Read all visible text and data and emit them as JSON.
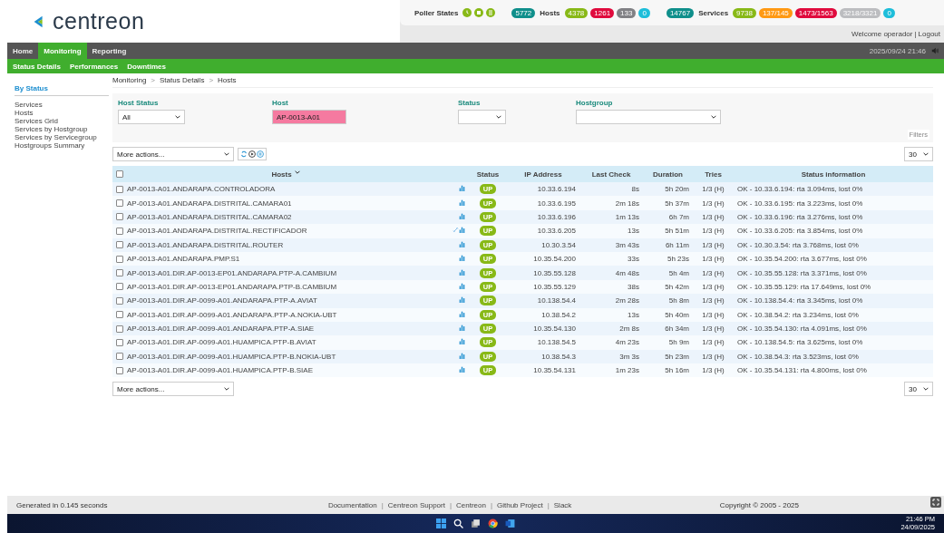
{
  "header": {
    "logo": "centreon",
    "poller_label": "Poller States",
    "hosts_label": "Hosts",
    "services_label": "Services",
    "host_badges": [
      {
        "text": "5772",
        "color": "#0f8f8b"
      },
      {
        "text": "4378",
        "color": "#88b917"
      },
      {
        "text": "1261",
        "color": "#e00b3d"
      },
      {
        "text": "133",
        "color": "#818185"
      },
      {
        "text": "0",
        "color": "#1ebeda"
      }
    ],
    "service_badges": [
      {
        "text": "14767",
        "color": "#0f8f8b"
      },
      {
        "text": "9738",
        "color": "#88b917"
      },
      {
        "text": "137/145",
        "color": "#ff9913"
      },
      {
        "text": "1473/1563",
        "color": "#e00b3d"
      },
      {
        "text": "3218/3321",
        "color": "#bcbdc0"
      },
      {
        "text": "0",
        "color": "#1ebeda"
      }
    ],
    "welcome": "Welcome operador",
    "welcome_separator": "|",
    "logout": "Logout",
    "datetime": "2025/09/24 21:46"
  },
  "menu": [
    {
      "label": "Home",
      "selected": false
    },
    {
      "label": "Monitoring",
      "selected": true
    },
    {
      "label": "Reporting",
      "selected": false
    }
  ],
  "submenu": [
    "Status Details",
    "Performances",
    "Downtimes"
  ],
  "sidebar": {
    "heading": "By Status",
    "items": [
      "Services",
      "Hosts",
      "Services Grid",
      "Services by Hostgroup",
      "Services by Servicegroup",
      "Hostgroups Summary"
    ]
  },
  "breadcrumb": [
    {
      "kind": "link",
      "text": "Monitoring"
    },
    {
      "kind": "separator",
      "text": ">"
    },
    {
      "kind": "link",
      "text": "Status Details"
    },
    {
      "kind": "separator",
      "text": ">"
    },
    {
      "kind": "link",
      "text": "Hosts"
    }
  ],
  "filters": {
    "host_status": {
      "label": "Host Status",
      "value": "All"
    },
    "host": {
      "label": "Host",
      "value": "AP-0013-A01"
    },
    "status": {
      "label": "Status"
    },
    "hostgroup": {
      "label": "Hostgroup"
    },
    "filters_label": "Filters"
  },
  "actions_top": {
    "more_actions": "More actions...",
    "per_page": "30"
  },
  "actions_bottom": {
    "more_actions": "More actions...",
    "per_page": "30"
  },
  "table": {
    "columns": [
      "Hosts",
      "Status",
      "IP Address",
      "Last Check",
      "Duration",
      "Tries",
      "Status information"
    ],
    "all_checked": false,
    "rows": [
      {
        "host": "AP-0013-A01.ANDARAPA.CONTROLADORA",
        "linked": false,
        "status": "UP",
        "ip": "10.33.6.194",
        "last_check": "8s",
        "duration": "5h 20m",
        "tries": "1/3 (H)",
        "info": "OK - 10.33.6.194: rta 3.094ms, lost 0%",
        "checked": false
      },
      {
        "host": "AP-0013-A01.ANDARAPA.DISTRITAL.CAMARA01",
        "linked": false,
        "status": "UP",
        "ip": "10.33.6.195",
        "last_check": "2m 18s",
        "duration": "5h 37m",
        "tries": "1/3 (H)",
        "info": "OK - 10.33.6.195: rta 3.223ms, lost 0%",
        "checked": false
      },
      {
        "host": "AP-0013-A01.ANDARAPA.DISTRITAL.CAMARA02",
        "linked": false,
        "status": "UP",
        "ip": "10.33.6.196",
        "last_check": "1m 13s",
        "duration": "6h 7m",
        "tries": "1/3 (H)",
        "info": "OK - 10.33.6.196: rta 3.276ms, lost 0%",
        "checked": false
      },
      {
        "host": "AP-0013-A01.ANDARAPA.DISTRITAL.RECTIFICADOR",
        "linked": true,
        "status": "UP",
        "ip": "10.33.6.205",
        "last_check": "13s",
        "duration": "5h 51m",
        "tries": "1/3 (H)",
        "info": "OK - 10.33.6.205: rta 3.854ms, lost 0%",
        "checked": false
      },
      {
        "host": "AP-0013-A01.ANDARAPA.DISTRITAL.ROUTER",
        "linked": false,
        "status": "UP",
        "ip": "10.30.3.54",
        "last_check": "3m 43s",
        "duration": "6h 11m",
        "tries": "1/3 (H)",
        "info": "OK - 10.30.3.54: rta 3.768ms, lost 0%",
        "checked": false
      },
      {
        "host": "AP-0013-A01.ANDARAPA.PMP.S1",
        "linked": false,
        "status": "UP",
        "ip": "10.35.54.200",
        "last_check": "33s",
        "duration": "5h 23s",
        "tries": "1/3 (H)",
        "info": "OK - 10.35.54.200: rta 3.677ms, lost 0%",
        "checked": false
      },
      {
        "host": "AP-0013-A01.DIR.AP-0013-EP01.ANDARAPA.PTP-A.CAMBIUM",
        "linked": false,
        "status": "UP",
        "ip": "10.35.55.128",
        "last_check": "4m 48s",
        "duration": "5h 4m",
        "tries": "1/3 (H)",
        "info": "OK - 10.35.55.128: rta 3.371ms, lost 0%",
        "checked": false
      },
      {
        "host": "AP-0013-A01.DIR.AP-0013-EP01.ANDARAPA.PTP-B.CAMBIUM",
        "linked": false,
        "status": "UP",
        "ip": "10.35.55.129",
        "last_check": "38s",
        "duration": "5h 42m",
        "tries": "1/3 (H)",
        "info": "OK - 10.35.55.129: rta 17.649ms, lost 0%",
        "checked": false
      },
      {
        "host": "AP-0013-A01.DIR.AP-0099-A01.ANDARAPA.PTP-A.AVIAT",
        "linked": false,
        "status": "UP",
        "ip": "10.138.54.4",
        "last_check": "2m 28s",
        "duration": "5h 8m",
        "tries": "1/3 (H)",
        "info": "OK - 10.138.54.4: rta 3.345ms, lost 0%",
        "checked": false
      },
      {
        "host": "AP-0013-A01.DIR.AP-0099-A01.ANDARAPA.PTP-A.NOKIA-UBT",
        "linked": false,
        "status": "UP",
        "ip": "10.38.54.2",
        "last_check": "13s",
        "duration": "5h 40m",
        "tries": "1/3 (H)",
        "info": "OK - 10.38.54.2: rta 3.234ms, lost 0%",
        "checked": false
      },
      {
        "host": "AP-0013-A01.DIR.AP-0099-A01.ANDARAPA.PTP-A.SIAE",
        "linked": false,
        "status": "UP",
        "ip": "10.35.54.130",
        "last_check": "2m 8s",
        "duration": "6h 34m",
        "tries": "1/3 (H)",
        "info": "OK - 10.35.54.130: rta 4.091ms, lost 0%",
        "checked": false
      },
      {
        "host": "AP-0013-A01.DIR.AP-0099-A01.HUAMPICA.PTP-B.AVIAT",
        "linked": false,
        "status": "UP",
        "ip": "10.138.54.5",
        "last_check": "4m 23s",
        "duration": "5h 9m",
        "tries": "1/3 (H)",
        "info": "OK - 10.138.54.5: rta 3.625ms, lost 0%",
        "checked": false
      },
      {
        "host": "AP-0013-A01.DIR.AP-0099-A01.HUAMPICA.PTP-B.NOKIA-UBT",
        "linked": false,
        "status": "UP",
        "ip": "10.38.54.3",
        "last_check": "3m 3s",
        "duration": "5h 23m",
        "tries": "1/3 (H)",
        "info": "OK - 10.38.54.3: rta 3.523ms, lost 0%",
        "checked": false
      },
      {
        "host": "AP-0013-A01.DIR.AP-0099-A01.HUAMPICA.PTP-B.SIAE",
        "linked": false,
        "status": "UP",
        "ip": "10.35.54.131",
        "last_check": "1m 23s",
        "duration": "5h 16m",
        "tries": "1/3 (H)",
        "info": "OK - 10.35.54.131: rta 4.800ms, lost 0%",
        "checked": false
      }
    ]
  },
  "footer": {
    "generated": "Generated in 0.145 seconds",
    "links": [
      {
        "kind": "link",
        "text": "Documentation"
      },
      {
        "kind": "separator",
        "text": "|"
      },
      {
        "kind": "link",
        "text": "Centreon Support"
      },
      {
        "kind": "separator",
        "text": "|"
      },
      {
        "kind": "link",
        "text": "Centreon"
      },
      {
        "kind": "separator",
        "text": "|"
      },
      {
        "kind": "link",
        "text": "Github Project"
      },
      {
        "kind": "separator",
        "text": "|"
      },
      {
        "kind": "link",
        "text": "Slack"
      }
    ],
    "copyright": "Copyright © 2005 - 2025"
  },
  "taskbar": {
    "time": "21:46 PM",
    "date": "24/09/2025"
  }
}
